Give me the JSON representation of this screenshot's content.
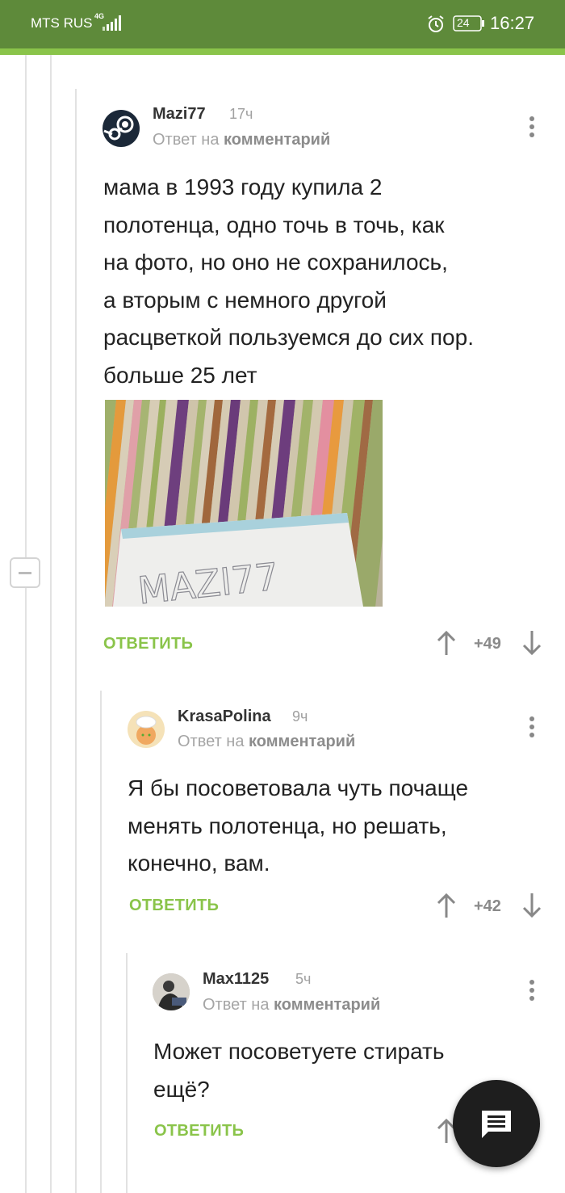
{
  "status_bar": {
    "carrier": "MTS RUS",
    "network": "4G",
    "battery": "24",
    "time": "16:27"
  },
  "comments": [
    {
      "username": "Mazi77",
      "time": "17ч",
      "reply_prefix": "Ответ на",
      "reply_target": "комментарий",
      "text_lines": [
        "мама в 1993 году купила 2",
        "полотенца, одно точь в точь, как",
        "на фото, но оно не сохранилось,",
        "а вторым с немного другой",
        "расцветкой пользуемся до сих пор.",
        "больше 25 лет"
      ],
      "photo_caption": "MAZI77",
      "reply_label": "ОТВЕТИТЬ",
      "score": "+49"
    },
    {
      "username": "KrasaPolina",
      "time": "9ч",
      "reply_prefix": "Ответ на",
      "reply_target": "комментарий",
      "text_lines": [
        "Я бы посоветовала чуть почаще",
        "менять полотенца, но решать,",
        "конечно, вам."
      ],
      "reply_label": "ОТВЕТИТЬ",
      "score": "+42"
    },
    {
      "username": "Max1125",
      "time": "5ч",
      "reply_prefix": "Ответ на",
      "reply_target": "комментарий",
      "text_lines": [
        "Может посоветуете стирать",
        "ещё?"
      ],
      "reply_label": "ОТВЕТИТЬ"
    }
  ],
  "icons": {
    "avatar_1": "steam-icon",
    "avatar_2": "chef-avatar",
    "avatar_3": "user-photo-avatar",
    "fab": "comment-icon"
  },
  "colors": {
    "status_bar": "#5e8a3a",
    "accent": "#8ac44a",
    "fab": "#1e1e1e"
  }
}
